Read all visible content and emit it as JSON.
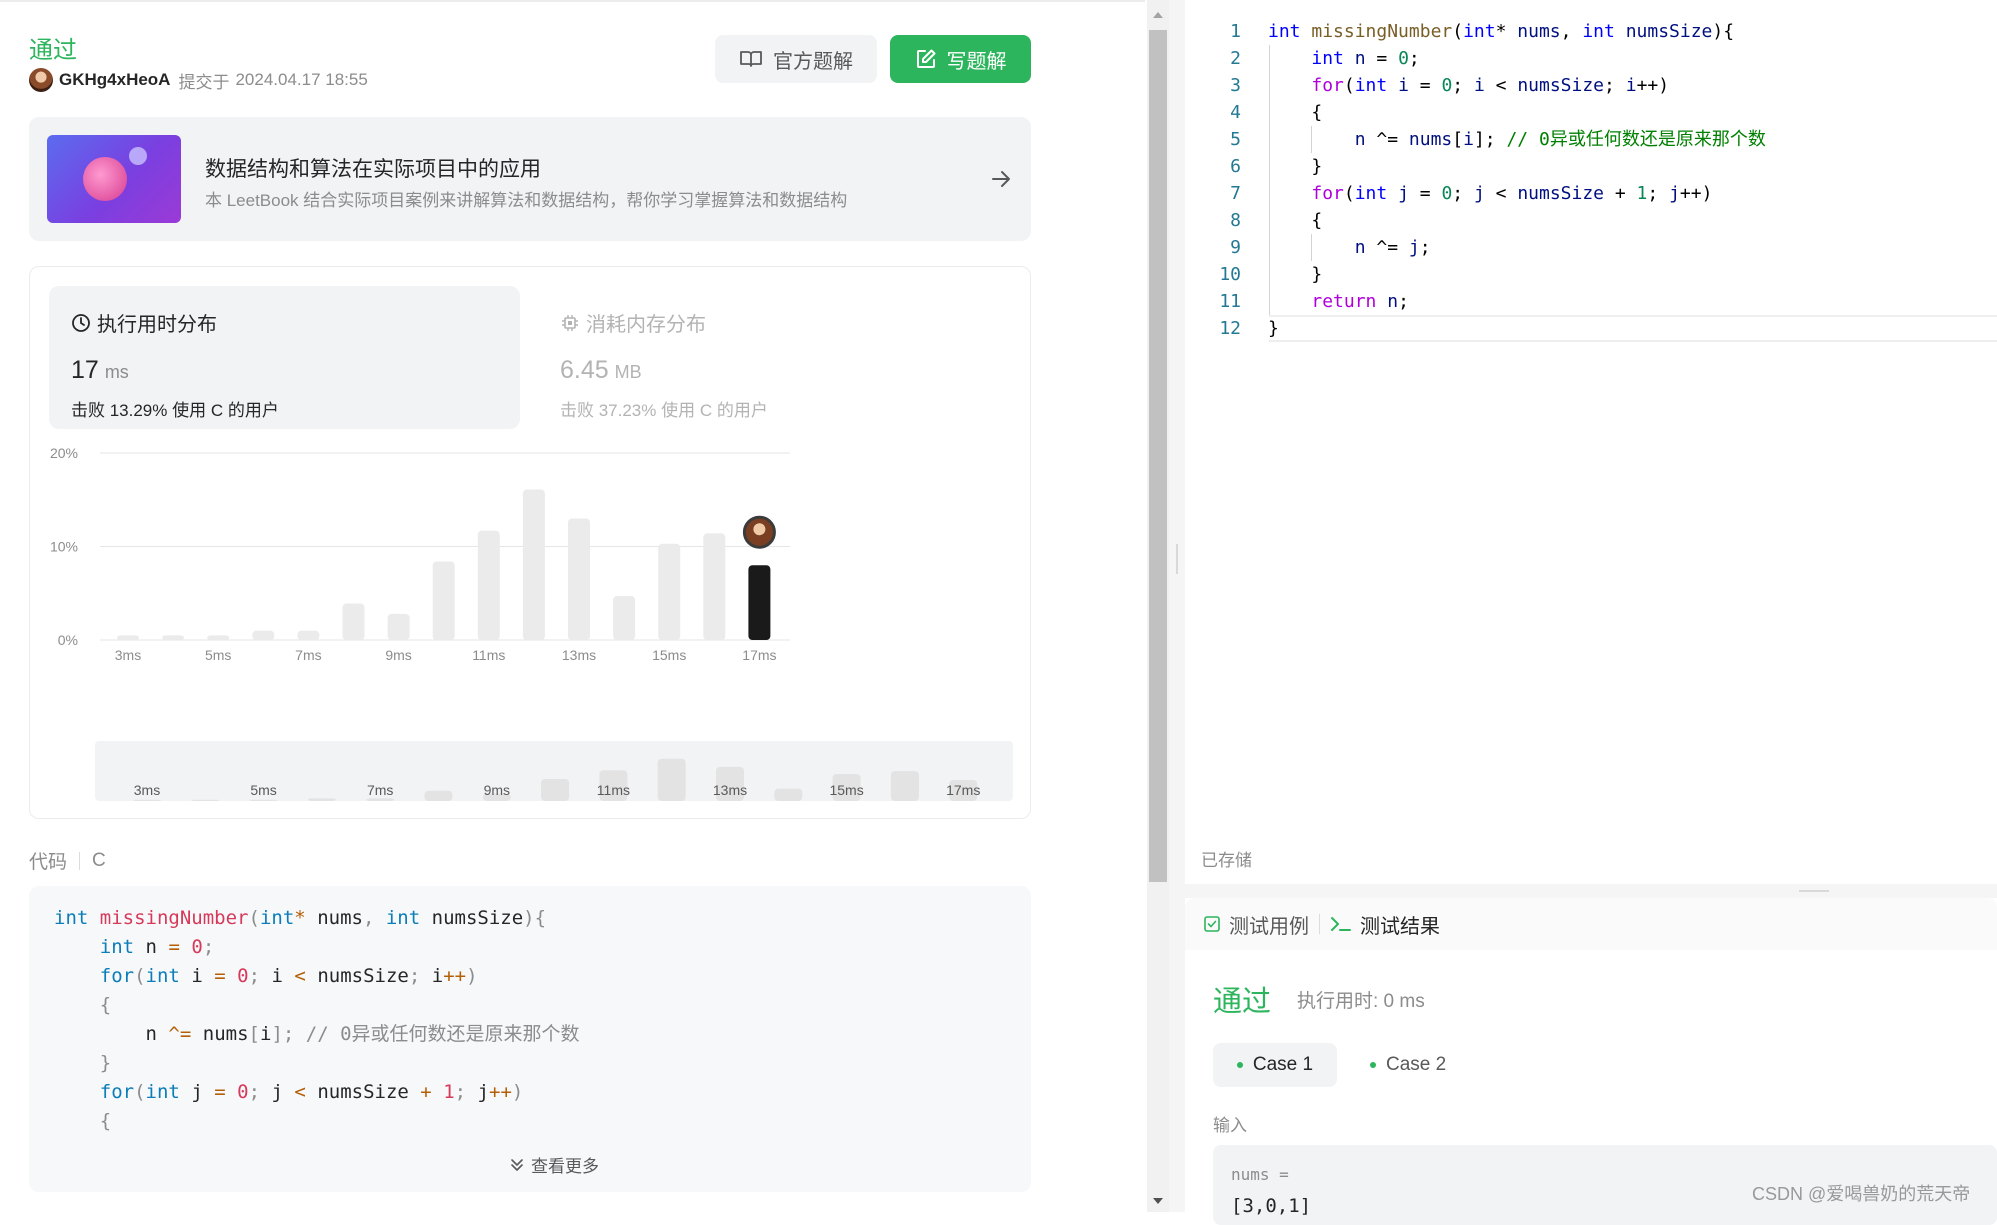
{
  "header": {
    "status": "通过",
    "submitter": "GKHg4xHeoA",
    "submitted_prefix": "提交于",
    "submitted_time": "2024.04.17 18:55",
    "official_solution_label": "官方题解",
    "write_solution_label": "写题解"
  },
  "leetbook": {
    "title": "数据结构和算法在实际项目中的应用",
    "description": "本 LeetBook 结合实际项目案例来讲解算法和数据结构，帮你学习掌握算法和数据结构"
  },
  "runtime": {
    "title": "执行用时分布",
    "value": "17",
    "unit": "ms",
    "beat": "击败 13.29% 使用 C 的用户"
  },
  "memory": {
    "title": "消耗内存分布",
    "value": "6.45",
    "unit": "MB",
    "beat": "击败 37.23% 使用 C 的用户"
  },
  "chart_data": {
    "type": "bar",
    "categories": [
      "3ms",
      "4ms",
      "5ms",
      "6ms",
      "7ms",
      "8ms",
      "9ms",
      "10ms",
      "11ms",
      "12ms",
      "13ms",
      "14ms",
      "15ms",
      "16ms",
      "17ms"
    ],
    "x_tick_labels": [
      "3ms",
      "5ms",
      "7ms",
      "9ms",
      "11ms",
      "13ms",
      "15ms",
      "17ms"
    ],
    "y_tick_labels": [
      "20%",
      "10%",
      "0%"
    ],
    "values": [
      0.5,
      0.5,
      0.5,
      1.0,
      1.0,
      3.9,
      2.8,
      8.4,
      11.7,
      16.1,
      13.0,
      4.7,
      10.3,
      11.4,
      8.0
    ],
    "highlight_index": 14,
    "ylim": [
      0,
      20
    ],
    "grid": true,
    "colors": {
      "bar": "#ebebeb",
      "highlight": "#1a1a1a",
      "grid": "#e6e6e6"
    }
  },
  "code": {
    "label": "代码",
    "lang": "C",
    "view_more": "查看更多"
  },
  "editor": {
    "saved": "已存储"
  },
  "result": {
    "tab_testcase": "测试用例",
    "tab_result": "测试结果",
    "status": "通过",
    "runtime": "执行用时: 0 ms",
    "case1": "Case 1",
    "case2": "Case 2",
    "input_label": "输入",
    "input_var": "nums =",
    "input_value": "[3,0,1]"
  },
  "watermark": "CSDN @爱喝兽奶的荒天帝"
}
